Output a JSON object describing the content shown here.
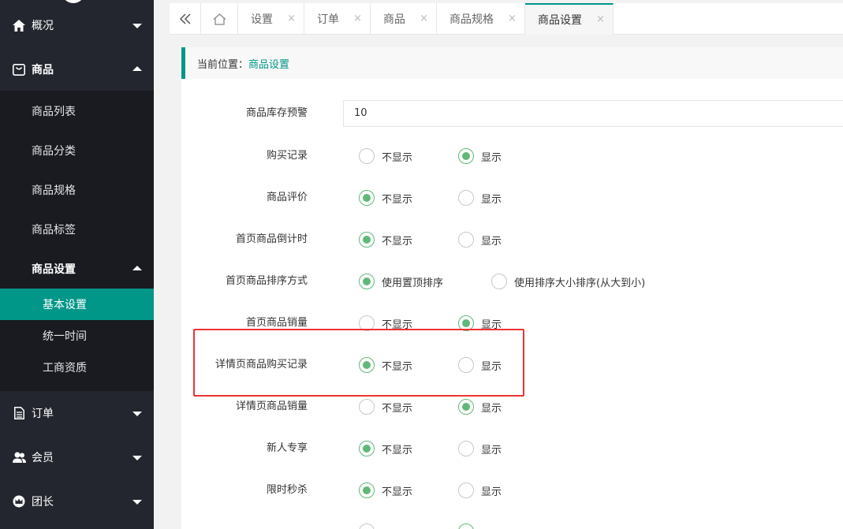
{
  "sidebar": {
    "menus": [
      {
        "label": "概况",
        "icon": "home-icon"
      },
      {
        "label": "商品",
        "icon": "shopping-bag-icon"
      },
      {
        "label": "订单",
        "icon": "document-icon"
      },
      {
        "label": "会员",
        "icon": "users-icon"
      },
      {
        "label": "团长",
        "icon": "crown-icon"
      }
    ],
    "goods_sub": [
      "商品列表",
      "商品分类",
      "商品规格",
      "商品标签",
      "商品设置"
    ],
    "settings_sub": [
      "基本设置",
      "统一时间",
      "工商资质"
    ]
  },
  "tabs": [
    {
      "label": "设置",
      "close": "×"
    },
    {
      "label": "订单",
      "close": "×"
    },
    {
      "label": "商品",
      "close": "×"
    },
    {
      "label": "商品规格",
      "close": "×"
    },
    {
      "label": "商品设置",
      "close": "×"
    }
  ],
  "breadcrumb": {
    "prefix": "当前位置：",
    "current": "商品设置"
  },
  "form": {
    "stock_warning": {
      "label": "商品库存预警",
      "value": "10"
    },
    "rows": [
      {
        "label": "购买记录",
        "opt1": "不显示",
        "opt2": "显示",
        "selected": 2
      },
      {
        "label": "商品评价",
        "opt1": "不显示",
        "opt2": "显示",
        "selected": 1
      },
      {
        "label": "首页商品倒计时",
        "opt1": "不显示",
        "opt2": "显示",
        "selected": 1
      },
      {
        "label": "首页商品排序方式",
        "opt1": "使用置顶排序",
        "opt2": "使用排序大小排序(从大到小)",
        "selected": 1
      },
      {
        "label": "首页商品销量",
        "opt1": "不显示",
        "opt2": "显示",
        "selected": 2
      },
      {
        "label": "详情页商品购买记录",
        "opt1": "不显示",
        "opt2": "显示",
        "selected": 1
      },
      {
        "label": "详情页商品销量",
        "opt1": "不显示",
        "opt2": "显示",
        "selected": 2
      },
      {
        "label": "新人专享",
        "opt1": "不显示",
        "opt2": "显示",
        "selected": 1
      },
      {
        "label": "限时秒杀",
        "opt1": "不显示",
        "opt2": "显示",
        "selected": 1
      }
    ]
  }
}
